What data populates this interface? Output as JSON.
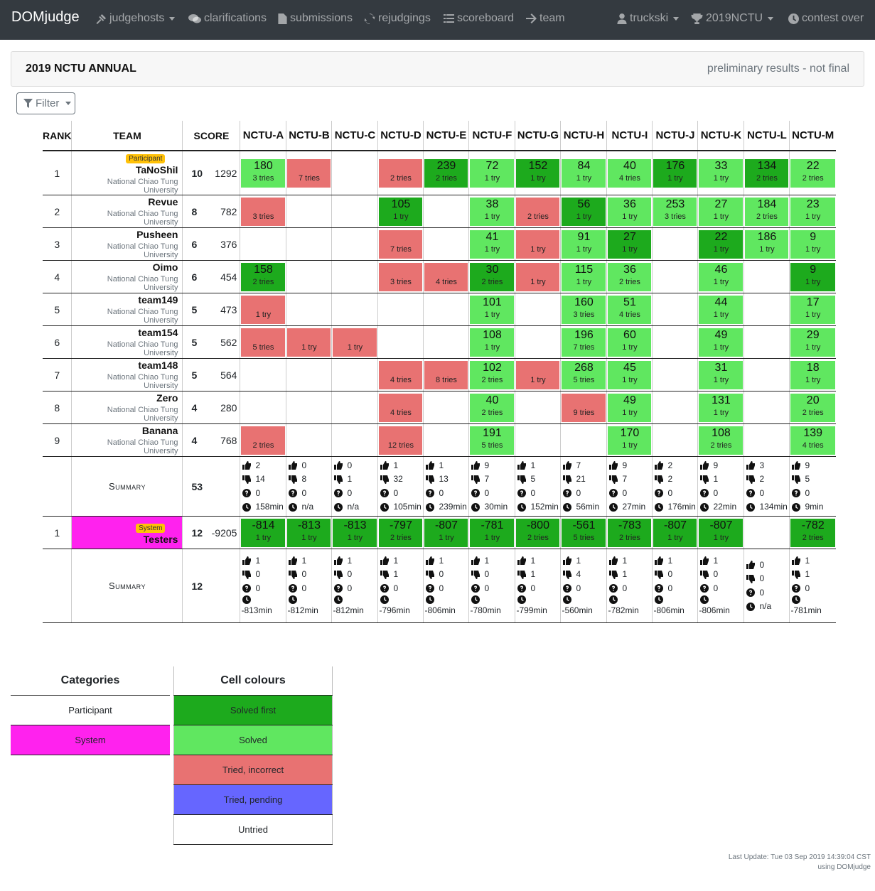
{
  "nav": {
    "brand": "DOMjudge",
    "judgehosts": "judgehosts",
    "clarifications": "clarifications",
    "submissions": "submissions",
    "rejudgings": "rejudgings",
    "scoreboard": "scoreboard",
    "team": "team",
    "user": "truckski",
    "contest": "2019NCTU",
    "contest_status": "contest over"
  },
  "header": {
    "title": "2019 NCTU ANNUAL",
    "status": "preliminary results - not final"
  },
  "filter_label": "Filter",
  "columns": {
    "rank": "RANK",
    "team": "TEAM",
    "score": "SCORE",
    "problems": [
      "NCTU-A",
      "NCTU-B",
      "NCTU-C",
      "NCTU-D",
      "NCTU-E",
      "NCTU-F",
      "NCTU-G",
      "NCTU-H",
      "NCTU-I",
      "NCTU-J",
      "NCTU-K",
      "NCTU-L",
      "NCTU-M"
    ]
  },
  "teams": [
    {
      "rank": "1",
      "name": "TaNoShiI",
      "affiliation": "National Chiao Tung University",
      "category": "Participant",
      "solved": "10",
      "penalty": "1292",
      "cells": [
        [
          "s",
          "180",
          "3 tries"
        ],
        [
          "w",
          "",
          "7 tries"
        ],
        [
          "",
          ""
        ],
        [
          "w",
          "",
          "2 tries"
        ],
        [
          "f",
          "239",
          "2 tries"
        ],
        [
          "s",
          "72",
          "1 try"
        ],
        [
          "f",
          "152",
          "1 try"
        ],
        [
          "s",
          "84",
          "1 try"
        ],
        [
          "s",
          "40",
          "4 tries"
        ],
        [
          "f",
          "176",
          "1 try"
        ],
        [
          "s",
          "33",
          "1 try"
        ],
        [
          "f",
          "134",
          "2 tries"
        ],
        [
          "s",
          "22",
          "2 tries"
        ]
      ]
    },
    {
      "rank": "2",
      "name": "Revue",
      "affiliation": "National Chiao Tung University",
      "solved": "8",
      "penalty": "782",
      "cells": [
        [
          "w",
          "",
          "3 tries"
        ],
        [
          "",
          ""
        ],
        [
          "",
          ""
        ],
        [
          "f",
          "105",
          "1 try"
        ],
        [
          "",
          ""
        ],
        [
          "s",
          "38",
          "1 try"
        ],
        [
          "w",
          "",
          "2 tries"
        ],
        [
          "f",
          "56",
          "1 try"
        ],
        [
          "s",
          "36",
          "1 try"
        ],
        [
          "s",
          "253",
          "3 tries"
        ],
        [
          "s",
          "27",
          "1 try"
        ],
        [
          "s",
          "184",
          "2 tries"
        ],
        [
          "s",
          "23",
          "1 try"
        ]
      ]
    },
    {
      "rank": "3",
      "name": "Pusheen",
      "affiliation": "National Chiao Tung University",
      "solved": "6",
      "penalty": "376",
      "cells": [
        [
          "",
          ""
        ],
        [
          "",
          ""
        ],
        [
          "",
          ""
        ],
        [
          "w",
          "",
          "7 tries"
        ],
        [
          "",
          ""
        ],
        [
          "s",
          "41",
          "1 try"
        ],
        [
          "w",
          "",
          "1 try"
        ],
        [
          "s",
          "91",
          "1 try"
        ],
        [
          "f",
          "27",
          "1 try"
        ],
        [
          "",
          ""
        ],
        [
          "f",
          "22",
          "1 try"
        ],
        [
          "s",
          "186",
          "1 try"
        ],
        [
          "s",
          "9",
          "1 try"
        ]
      ]
    },
    {
      "rank": "4",
      "name": "Oimo",
      "affiliation": "National Chiao Tung University",
      "solved": "6",
      "penalty": "454",
      "cells": [
        [
          "f",
          "158",
          "2 tries"
        ],
        [
          "",
          ""
        ],
        [
          "",
          ""
        ],
        [
          "w",
          "",
          "3 tries"
        ],
        [
          "w",
          "",
          "4 tries"
        ],
        [
          "f",
          "30",
          "2 tries"
        ],
        [
          "w",
          "",
          "1 try"
        ],
        [
          "s",
          "115",
          "1 try"
        ],
        [
          "s",
          "36",
          "2 tries"
        ],
        [
          "",
          ""
        ],
        [
          "s",
          "46",
          "1 try"
        ],
        [
          "",
          ""
        ],
        [
          "f",
          "9",
          "1 try"
        ]
      ]
    },
    {
      "rank": "5",
      "name": "team149",
      "affiliation": "National Chiao Tung University",
      "solved": "5",
      "penalty": "473",
      "cells": [
        [
          "w",
          "",
          "1 try"
        ],
        [
          "",
          ""
        ],
        [
          "",
          ""
        ],
        [
          "",
          ""
        ],
        [
          "",
          ""
        ],
        [
          "s",
          "101",
          "1 try"
        ],
        [
          "",
          ""
        ],
        [
          "s",
          "160",
          "3 tries"
        ],
        [
          "s",
          "51",
          "4 tries"
        ],
        [
          "",
          ""
        ],
        [
          "s",
          "44",
          "1 try"
        ],
        [
          "",
          ""
        ],
        [
          "s",
          "17",
          "1 try"
        ]
      ]
    },
    {
      "rank": "6",
      "name": "team154",
      "affiliation": "National Chiao Tung University",
      "solved": "5",
      "penalty": "562",
      "cells": [
        [
          "w",
          "",
          "5 tries"
        ],
        [
          "w",
          "",
          "1 try"
        ],
        [
          "w",
          "",
          "1 try"
        ],
        [
          "",
          ""
        ],
        [
          "",
          ""
        ],
        [
          "s",
          "108",
          "1 try"
        ],
        [
          "",
          ""
        ],
        [
          "s",
          "196",
          "7 tries"
        ],
        [
          "s",
          "60",
          "1 try"
        ],
        [
          "",
          ""
        ],
        [
          "s",
          "49",
          "1 try"
        ],
        [
          "",
          ""
        ],
        [
          "s",
          "29",
          "1 try"
        ]
      ]
    },
    {
      "rank": "7",
      "name": "team148",
      "affiliation": "National Chiao Tung University",
      "solved": "5",
      "penalty": "564",
      "cells": [
        [
          "",
          ""
        ],
        [
          "",
          ""
        ],
        [
          "",
          ""
        ],
        [
          "w",
          "",
          "4 tries"
        ],
        [
          "w",
          "",
          "8 tries"
        ],
        [
          "s",
          "102",
          "2 tries"
        ],
        [
          "w",
          "",
          "1 try"
        ],
        [
          "s",
          "268",
          "5 tries"
        ],
        [
          "s",
          "45",
          "1 try"
        ],
        [
          "",
          ""
        ],
        [
          "s",
          "31",
          "1 try"
        ],
        [
          "",
          ""
        ],
        [
          "s",
          "18",
          "1 try"
        ]
      ]
    },
    {
      "rank": "8",
      "name": "Zero",
      "affiliation": "National Chiao Tung University",
      "solved": "4",
      "penalty": "280",
      "cells": [
        [
          "",
          ""
        ],
        [
          "",
          ""
        ],
        [
          "",
          ""
        ],
        [
          "w",
          "",
          "4 tries"
        ],
        [
          "",
          ""
        ],
        [
          "s",
          "40",
          "2 tries"
        ],
        [
          "",
          ""
        ],
        [
          "w",
          "",
          "9 tries"
        ],
        [
          "s",
          "49",
          "1 try"
        ],
        [
          "",
          ""
        ],
        [
          "s",
          "131",
          "1 try"
        ],
        [
          "",
          ""
        ],
        [
          "s",
          "20",
          "2 tries"
        ]
      ]
    },
    {
      "rank": "9",
      "name": "Banana",
      "affiliation": "National Chiao Tung University",
      "solved": "4",
      "penalty": "768",
      "cells": [
        [
          "w",
          "",
          "2 tries"
        ],
        [
          "",
          ""
        ],
        [
          "",
          ""
        ],
        [
          "w",
          "",
          "12 tries"
        ],
        [
          "",
          ""
        ],
        [
          "s",
          "191",
          "5 tries"
        ],
        [
          "",
          ""
        ],
        [
          "",
          ""
        ],
        [
          "s",
          "170",
          "1 try"
        ],
        [
          "",
          ""
        ],
        [
          "s",
          "108",
          "2 tries"
        ],
        [
          "",
          ""
        ],
        [
          "s",
          "139",
          "4 tries"
        ]
      ]
    }
  ],
  "summary1": {
    "label": "Summary",
    "total": "53",
    "cols": [
      [
        "2",
        "14",
        "0",
        "158min"
      ],
      [
        "0",
        "8",
        "0",
        "n/a"
      ],
      [
        "0",
        "1",
        "0",
        "n/a"
      ],
      [
        "1",
        "32",
        "0",
        "105min"
      ],
      [
        "1",
        "13",
        "0",
        "239min"
      ],
      [
        "9",
        "7",
        "0",
        "30min"
      ],
      [
        "1",
        "5",
        "0",
        "152min"
      ],
      [
        "7",
        "21",
        "0",
        "56min"
      ],
      [
        "9",
        "7",
        "0",
        "27min"
      ],
      [
        "2",
        "2",
        "0",
        "176min"
      ],
      [
        "9",
        "1",
        "0",
        "22min"
      ],
      [
        "3",
        "2",
        "0",
        "134min"
      ],
      [
        "9",
        "5",
        "0",
        "9min"
      ]
    ]
  },
  "system_team": {
    "rank": "1",
    "name": "Testers",
    "category": "System",
    "solved": "12",
    "penalty": "-9205",
    "cells": [
      [
        "f",
        "-814",
        "1 try"
      ],
      [
        "f",
        "-813",
        "1 try"
      ],
      [
        "f",
        "-813",
        "1 try"
      ],
      [
        "f",
        "-797",
        "2 tries"
      ],
      [
        "f",
        "-807",
        "1 try"
      ],
      [
        "f",
        "-781",
        "1 try"
      ],
      [
        "f",
        "-800",
        "2 tries"
      ],
      [
        "f",
        "-561",
        "5 tries"
      ],
      [
        "f",
        "-783",
        "2 tries"
      ],
      [
        "f",
        "-807",
        "1 try"
      ],
      [
        "f",
        "-807",
        "1 try"
      ],
      [
        "",
        ""
      ],
      [
        "f",
        "-782",
        "2 tries"
      ]
    ]
  },
  "summary2": {
    "label": "Summary",
    "total": "12",
    "cols": [
      [
        "1",
        "0",
        "0",
        "-813min"
      ],
      [
        "1",
        "0",
        "0",
        "-812min"
      ],
      [
        "1",
        "0",
        "0",
        "-812min"
      ],
      [
        "1",
        "1",
        "0",
        "-796min"
      ],
      [
        "1",
        "0",
        "0",
        "-806min"
      ],
      [
        "1",
        "0",
        "0",
        "-780min"
      ],
      [
        "1",
        "1",
        "0",
        "-799min"
      ],
      [
        "1",
        "4",
        "0",
        "-560min"
      ],
      [
        "1",
        "1",
        "0",
        "-782min"
      ],
      [
        "1",
        "0",
        "0",
        "-806min"
      ],
      [
        "1",
        "0",
        "0",
        "-806min"
      ],
      [
        "0",
        "0",
        "0",
        "n/a"
      ],
      [
        "1",
        "1",
        "0",
        "-781min"
      ]
    ]
  },
  "legend_categories": {
    "title": "Categories",
    "items": [
      {
        "label": "Participant",
        "color": "#ffffff"
      },
      {
        "label": "System",
        "color": "#ff22ee"
      }
    ]
  },
  "legend_colours": {
    "title": "Cell colours",
    "items": [
      {
        "label": "Solved first",
        "color": "#1daa1d"
      },
      {
        "label": "Solved",
        "color": "#60e760"
      },
      {
        "label": "Tried, incorrect",
        "color": "#e87272"
      },
      {
        "label": "Tried, pending",
        "color": "#6666ff"
      },
      {
        "label": "Untried",
        "color": "#ffffff"
      }
    ]
  },
  "footer": {
    "updated": "Last Update: Tue 03 Sep 2019 14:39:04 CST",
    "using": "using DOMjudge"
  }
}
